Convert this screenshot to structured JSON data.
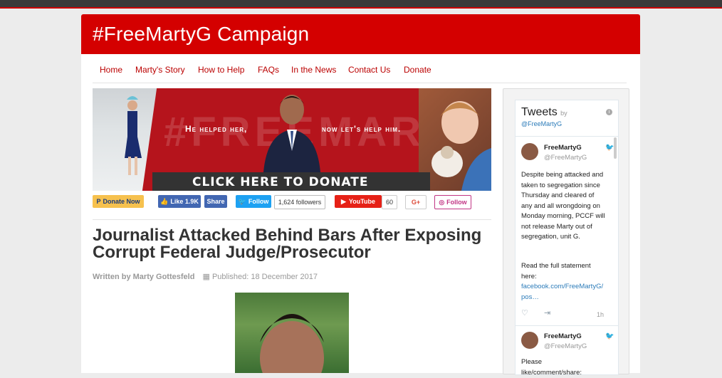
{
  "header": {
    "title": "#FreeMartyG Campaign"
  },
  "nav": {
    "items": [
      "Home",
      "Marty's Story",
      "How to Help",
      "FAQs",
      "In the News",
      "Contact Us",
      "Donate"
    ]
  },
  "banner": {
    "watermark": "#FREEMARTYG",
    "left_text": "He helped her,",
    "right_text": "now let's help him.",
    "cta": "CLICK HERE TO DONATE"
  },
  "social": {
    "donate": "Donate Now",
    "like": "Like 1.9K",
    "share": "Share",
    "twitter_follow": "Follow",
    "followers": "1,624 followers",
    "youtube": "YouTube",
    "youtube_count": "60",
    "gplus": "G+",
    "instagram": "Follow"
  },
  "article": {
    "title": "Journalist Attacked Behind Bars After Exposing Corrupt Federal Judge/Prosecutor",
    "author": "Written by Marty Gottesfeld",
    "published": "Published: 18 December 2017"
  },
  "tweets": {
    "heading": "Tweets",
    "by": "by",
    "handle_link": "@FreeMartyG",
    "items": [
      {
        "name": "FreeMartyG",
        "handle": "@FreeMartyG",
        "text": "Despite being attacked and taken to segregation since Thursday and cleared of any and all wrongdoing on Monday morning, PCCF will not release Marty out of segregation, unit G.",
        "text2": "Read the full statement here:",
        "link": "facebook.com/FreeMartyG/pos…",
        "time": "1h"
      },
      {
        "name": "FreeMartyG",
        "handle": "@FreeMartyG",
        "text": "Please like/comment/share:"
      }
    ]
  },
  "colors": {
    "brand_red": "#d40000",
    "link_red": "#b00",
    "twitter_blue": "#1da1f2",
    "facebook_blue": "#4267b2"
  }
}
